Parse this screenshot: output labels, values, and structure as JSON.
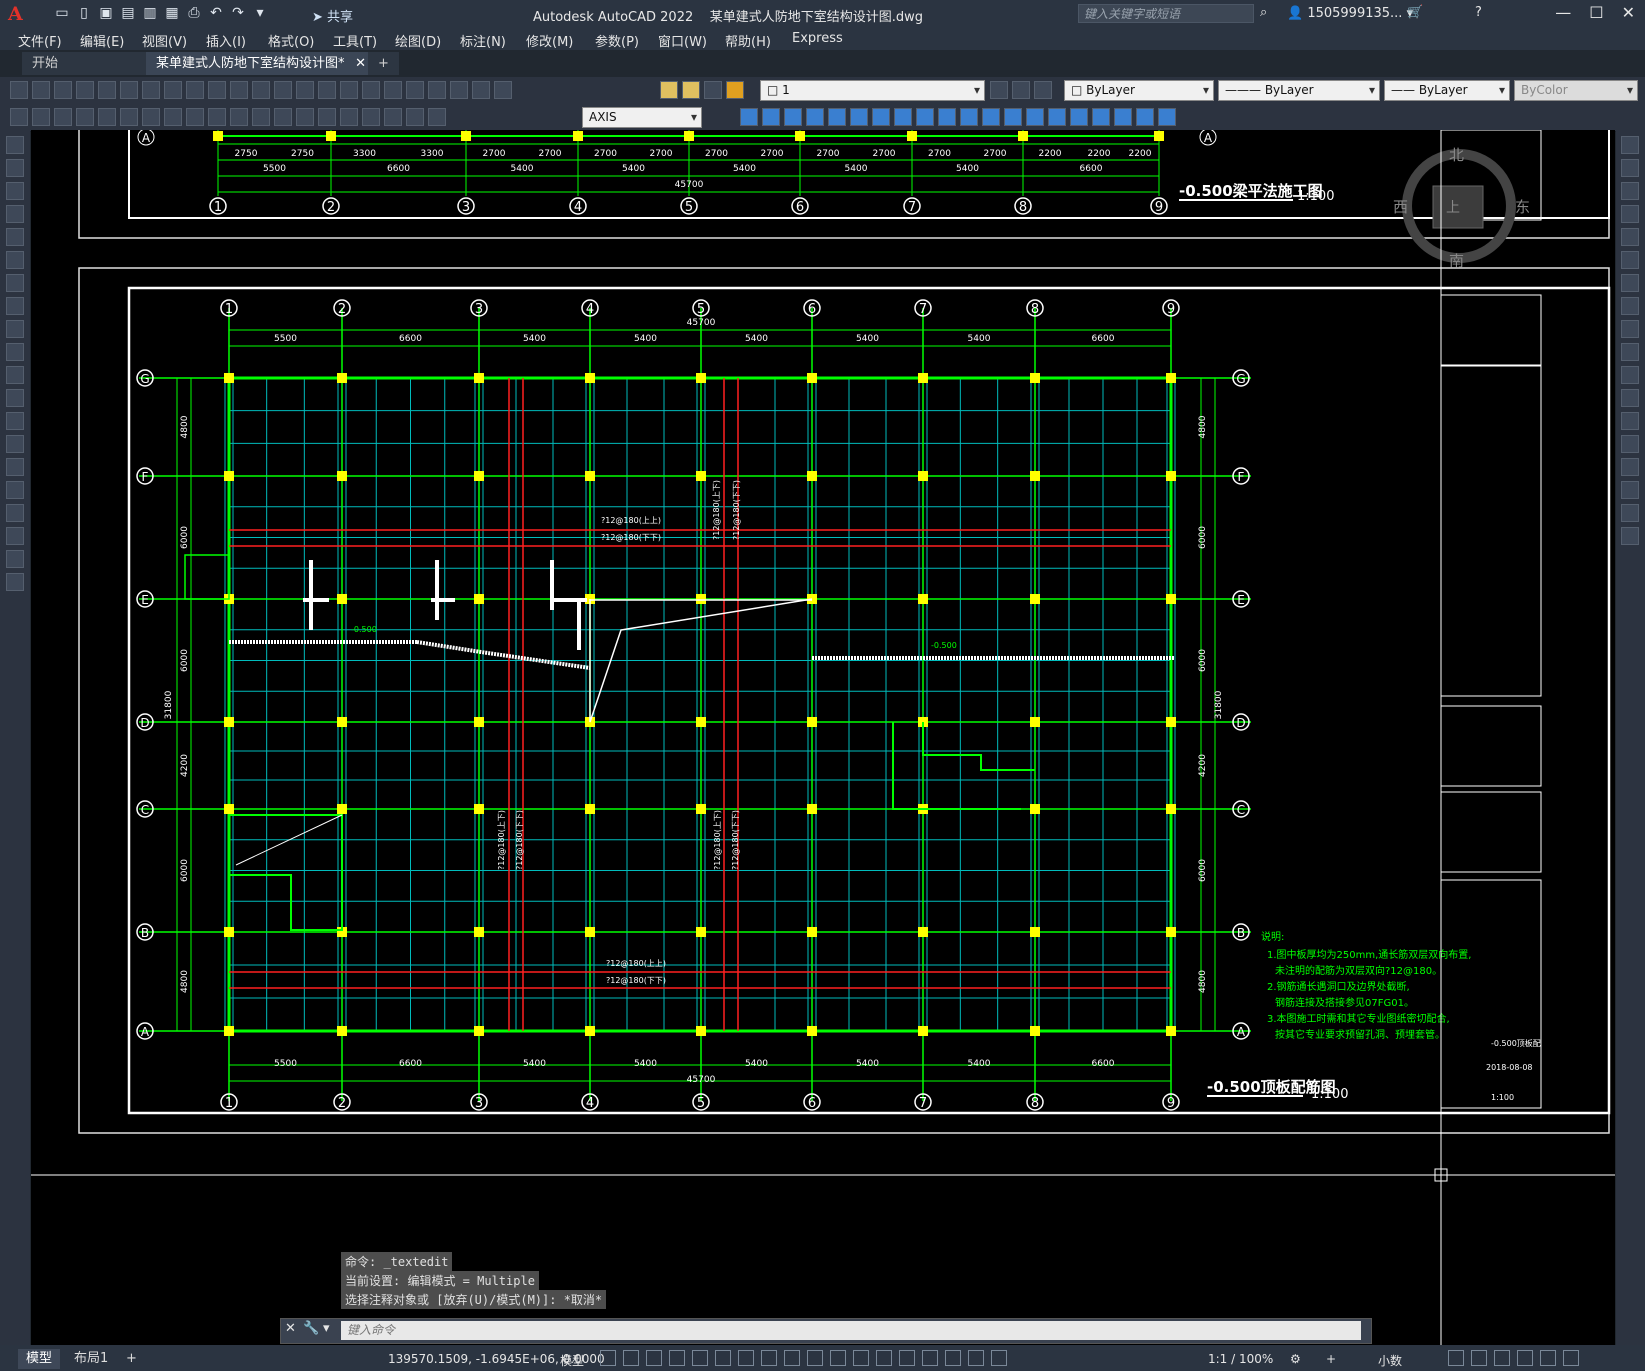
{
  "app": {
    "title": "Autodesk AutoCAD 2022",
    "filename": "某单建式人防地下室结构设计图.dwg"
  },
  "titlebar": {
    "share": "共享",
    "search_placeholder": "键入关键字或短语",
    "user": "1505999135..."
  },
  "menu": [
    "文件(F)",
    "编辑(E)",
    "视图(V)",
    "插入(I)",
    "格式(O)",
    "工具(T)",
    "绘图(D)",
    "标注(N)",
    "修改(M)",
    "参数(P)",
    "窗口(W)",
    "帮助(H)",
    "Express"
  ],
  "tabs": {
    "start": "开始",
    "doc": "某单建式人防地下室结构设计图*",
    "add": "+"
  },
  "properties": {
    "layer": "1",
    "color": "ByLayer",
    "linetype": "ByLayer",
    "lineweight": "ByLayer",
    "plotstyle": "ByColor",
    "dimstyle": "AXIS"
  },
  "viewcube": {
    "north": "北",
    "south": "南",
    "west": "西",
    "east": "东",
    "top": "上"
  },
  "drawing1": {
    "dims_top": [
      "2750",
      "2750",
      "3300",
      "3300",
      "2700",
      "2700",
      "2700",
      "2700",
      "2700",
      "2700",
      "2700",
      "2700",
      "2700",
      "2700",
      "2200",
      "2200",
      "2200"
    ],
    "dims_mid": [
      "5500",
      "6600",
      "5400",
      "5400",
      "5400",
      "5400",
      "5400",
      "6600"
    ],
    "total": "45700",
    "axes": [
      "1",
      "2",
      "3",
      "4",
      "5",
      "6",
      "7",
      "8",
      "9"
    ],
    "row": "A",
    "title": "-0.500梁平法施工图",
    "scale": "1:100"
  },
  "drawing2": {
    "axes": [
      "1",
      "2",
      "3",
      "4",
      "5",
      "6",
      "7",
      "8",
      "9"
    ],
    "rows": [
      "G",
      "F",
      "E",
      "D",
      "C",
      "B",
      "A"
    ],
    "dims": [
      "5500",
      "6600",
      "5400",
      "5400",
      "5400",
      "5400",
      "5400",
      "6600"
    ],
    "total": "45700",
    "row_dims": [
      "4800",
      "6000",
      "6000",
      "4200",
      "6000",
      "4800"
    ],
    "total_v": "31800",
    "rebar_top1": "?12@180(上上)",
    "rebar_top2": "?12@180(下下)",
    "rebar_bot1": "?12@180(上上)",
    "rebar_bot2": "?12@180(下下)",
    "rebar_v1": "?12@180(上下)",
    "rebar_v2": "?12@180(下下)",
    "elev": "-0.500",
    "notes_title": "说明:",
    "notes": [
      "1.图中板厚均为250mm,通长筋双层双向布置,",
      "未注明的配筋为双层双向?12@180。",
      "2.钢筋通长遇洞口及边界处截断,",
      "钢筋连接及搭接参见07FG01。",
      "3.本图施工时需和其它专业图纸密切配合,",
      "按其它专业要求预留孔洞、预埋套管。"
    ],
    "title": "-0.500顶板配筋图",
    "scale": "1:100"
  },
  "titleblock": {
    "scale": "1:100",
    "date": "2018-08-08",
    "drawing_label": "-0.500顶板配"
  },
  "command": {
    "history": [
      "命令: _textedit",
      "当前设置: 编辑模式 = Multiple",
      "选择注释对象或 [放弃(U)/模式(M)]: *取消*"
    ],
    "placeholder": "键入命令"
  },
  "status": {
    "model": "模型",
    "layout": "布局1",
    "add": "+",
    "coords": "139570.1509, -1.6945E+06, 0.0000",
    "space": "模型",
    "scale": "1:1 / 100%",
    "units": "小数"
  },
  "colors": {
    "green": "#00ff00",
    "cyan": "#00c8c8",
    "yellow": "#ffff00",
    "red": "#ff0000",
    "bg": "#000000"
  }
}
